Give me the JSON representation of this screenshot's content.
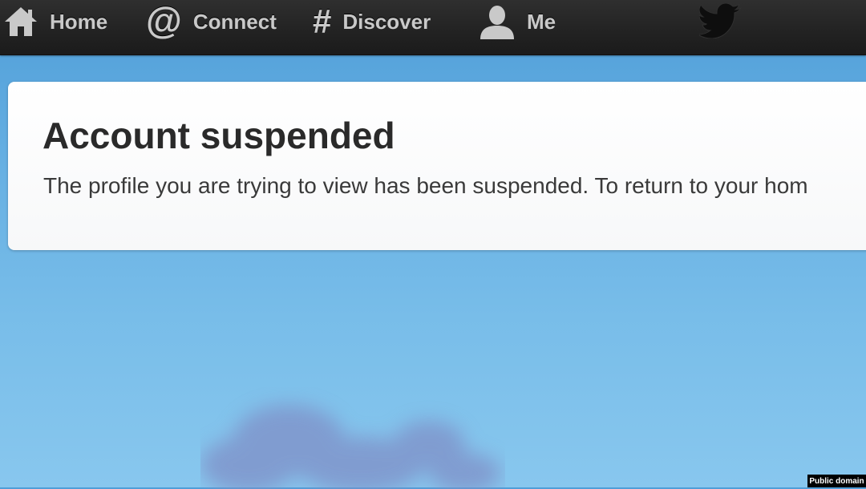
{
  "nav": {
    "items": [
      {
        "label": "Home",
        "icon": "home-icon"
      },
      {
        "label": "Connect",
        "icon": "at-icon"
      },
      {
        "label": "Discover",
        "icon": "hashtag-icon"
      },
      {
        "label": "Me",
        "icon": "user-icon"
      }
    ],
    "logo_icon": "twitter-bird-icon"
  },
  "notice": {
    "title": "Account suspended",
    "message": "The profile you are trying to view has been suspended. To return to your hom"
  },
  "credit": "Public domain",
  "colors": {
    "topbar": "#222222",
    "nav_text": "#c9c9c9",
    "background_sky": "#67b0e3",
    "card": "#ffffff",
    "title_text": "#2a2a2a"
  }
}
